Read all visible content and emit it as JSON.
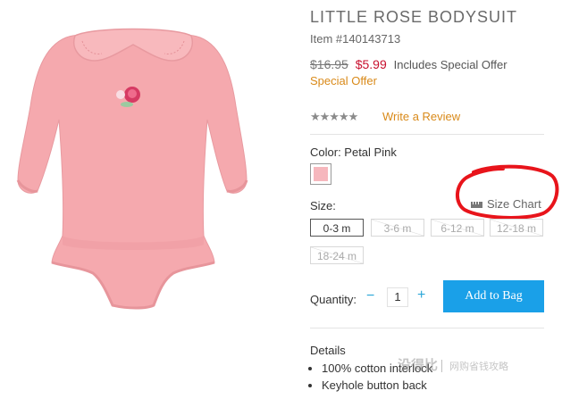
{
  "product": {
    "title": "LITTLE ROSE BODYSUIT",
    "item_number": "Item #140143713",
    "old_price": "$16.95",
    "new_price": "$5.99",
    "includes_text": "Includes Special Offer",
    "special_offer": "Special Offer",
    "rating_stars": "★★★★★",
    "rating_value": 0,
    "write_review": "Write a Review"
  },
  "color": {
    "label": "Color: Petal Pink",
    "swatch_color": "#f6b7bd"
  },
  "size": {
    "label": "Size:",
    "size_chart": "Size Chart",
    "options": [
      {
        "label": "0-3 m",
        "state": "selected"
      },
      {
        "label": "3-6 m",
        "state": "unavailable"
      },
      {
        "label": "6-12 m",
        "state": "unavailable"
      },
      {
        "label": "12-18 m",
        "state": "unavailable"
      },
      {
        "label": "18-24 m",
        "state": "unavailable"
      }
    ]
  },
  "quantity": {
    "label": "Quantity:",
    "minus": "−",
    "value": "1",
    "plus": "+"
  },
  "actions": {
    "add_to_bag": "Add to Bag",
    "accent_color": "#1aa0e8"
  },
  "details": {
    "heading": "Details",
    "items": [
      "100% cotton interlock",
      "Keyhole button back"
    ]
  },
  "watermark": {
    "main": "没得比",
    "sub": "网购省钱攻略"
  },
  "colors": {
    "price_red": "#c8102e",
    "link_orange": "#d98a1a",
    "annotation_red": "#e8141b"
  },
  "icons": {
    "size_chart": "ruler-icon"
  }
}
